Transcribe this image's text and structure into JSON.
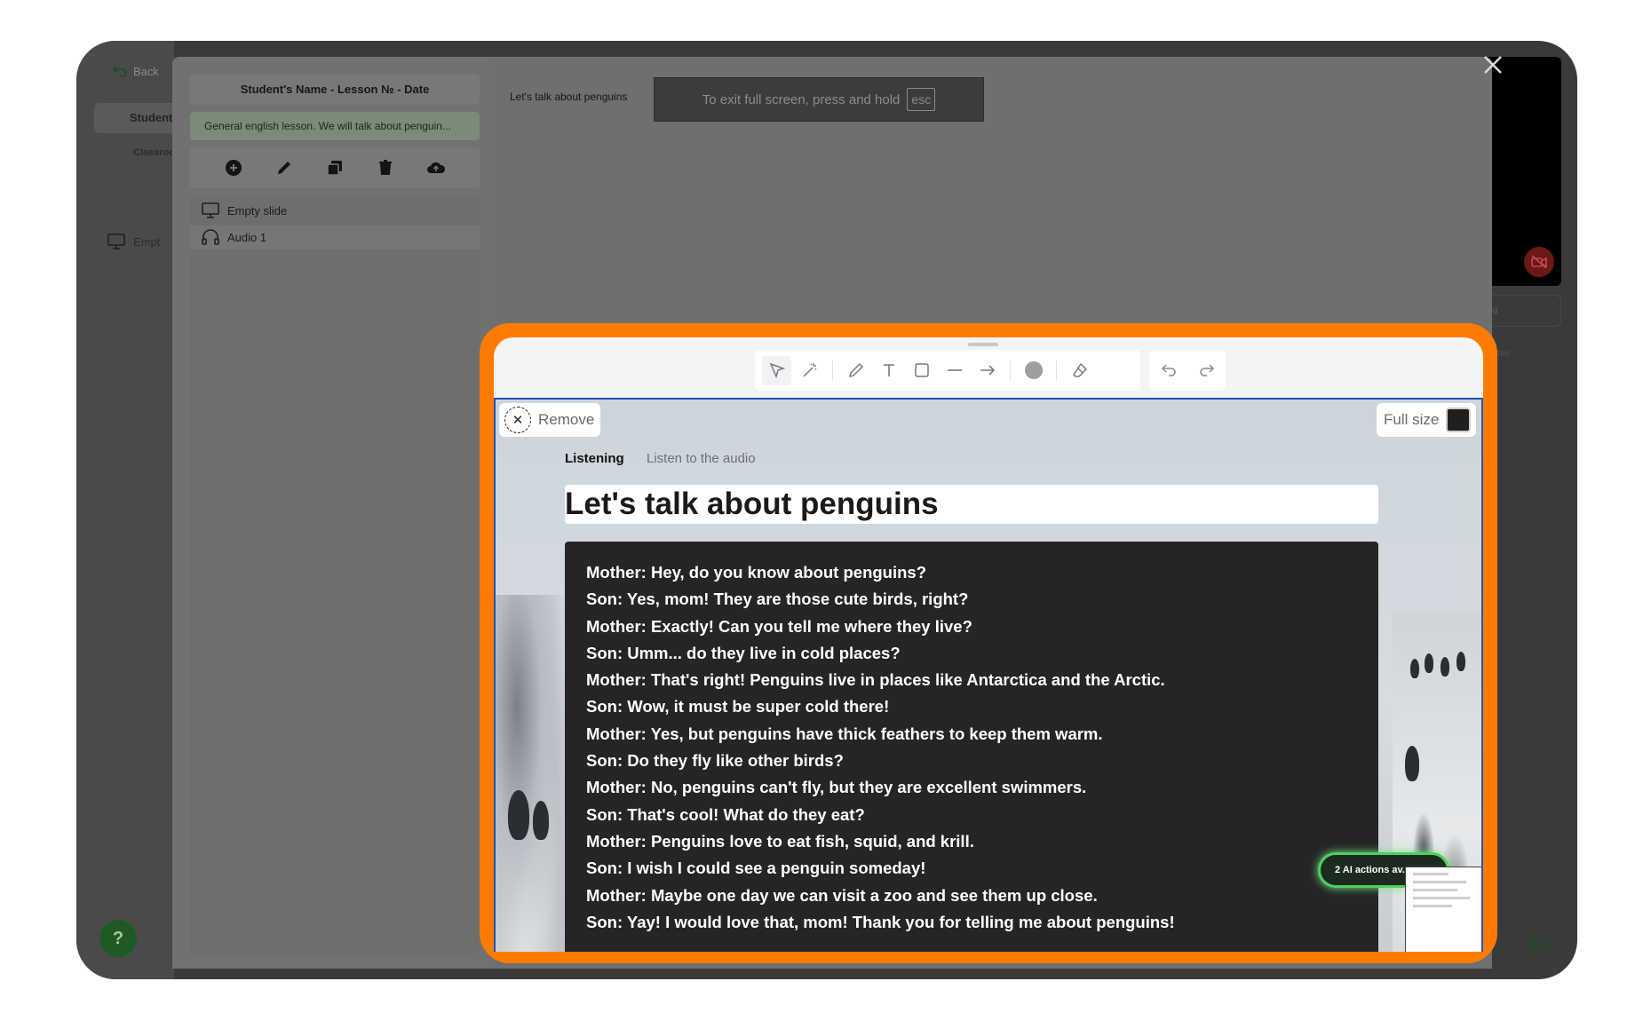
{
  "background_app": {
    "back_label": "Back",
    "student_tab": "Student",
    "classroom_tab": "Classroo",
    "empty_item": "Empt",
    "help_label": "?",
    "green_pill_text": "ing",
    "notes_label": "Notes"
  },
  "editor": {
    "lesson_title": "Student's Name - Lesson № - Date",
    "lesson_description": "General english lesson. We will talk about penguin...",
    "tools": [
      "plus-circle-icon",
      "pencil-icon",
      "copy-icon",
      "trash-icon",
      "cloud-upload-icon"
    ],
    "slides": [
      {
        "label": "Empty slide",
        "icon": "monitor-icon"
      },
      {
        "label": "Audio 1",
        "icon": "headphones-icon"
      }
    ],
    "canvas_slide_title": "Let's talk about penguins",
    "fullscreen_banner": {
      "text": "To exit full screen, press and hold",
      "key": "esc"
    }
  },
  "panel": {
    "toolbar": [
      "select-icon",
      "magic-wand-icon",
      "pen-icon",
      "text-icon",
      "rectangle-icon",
      "line-icon",
      "arrow-icon",
      "color-dot-icon",
      "eraser-icon",
      "undo-icon",
      "redo-icon"
    ],
    "remove_label": "Remove",
    "fullsize_label": "Full size",
    "tag_primary": "Listening",
    "tag_secondary": "Listen to the audio",
    "title": "Let's talk about penguins",
    "dialog": [
      "Mother: Hey, do you know about penguins?",
      "Son: Yes, mom! They are those cute birds, right?",
      "Mother: Exactly! Can you tell me where they live?",
      "Son: Umm... do they live in cold places?",
      "Mother: That's right! Penguins live in places like Antarctica and the Arctic.",
      "Son: Wow, it must be super cold there!",
      "Mother: Yes, but penguins have thick feathers to keep them warm.",
      "Son: Do they fly like other birds?",
      "Mother: No, penguins can't fly, but they are excellent swimmers.",
      "Son: That's cool! What do they eat?",
      "Mother: Penguins love to eat fish, squid, and krill.",
      "Son: I wish I could see a penguin someday!",
      "Mother: Maybe one day we can visit a zoo and see them up close.",
      "Son: Yay! I would love that, mom! Thank you for telling me about penguins!"
    ],
    "ai_pill": "2 AI actions av..."
  },
  "colors": {
    "highlight": "#ff7b00",
    "selection": "#2154b3",
    "ai_glow": "#4ad25c"
  }
}
